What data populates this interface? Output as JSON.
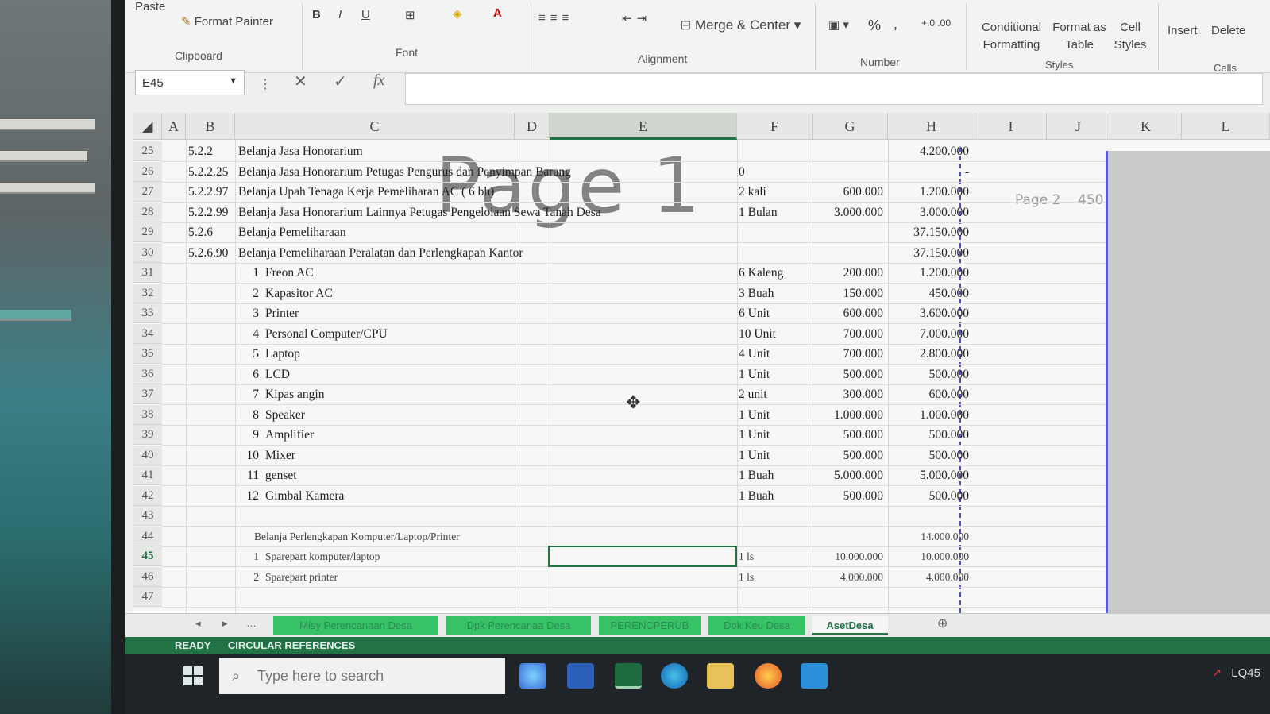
{
  "ribbon": {
    "paste": "Paste",
    "format_painter": "Format Painter",
    "clipboard_group": "Clipboard",
    "bold": "B",
    "italic": "I",
    "underline": "U",
    "font_group": "Font",
    "merge_center": "Merge & Center",
    "alignment_group": "Alignment",
    "percent": "%",
    "comma": ",",
    "number_group": "Number",
    "conditional_formatting": "Conditional Formatting",
    "format_as_table": "Format as Table",
    "cell_styles": "Cell Styles",
    "styles_group": "Styles",
    "insert": "Insert",
    "delete": "Delete",
    "cells_group": "Cells"
  },
  "formula_bar": {
    "name_box": "E45",
    "cancel": "✕",
    "enter": "✓",
    "fx": "fx",
    "formula": ""
  },
  "columns": [
    "A",
    "B",
    "C",
    "D",
    "E",
    "F",
    "G",
    "H",
    "I",
    "J",
    "K",
    "L"
  ],
  "selected_column": "E",
  "selected_row": "45",
  "rows": [
    {
      "num": "25",
      "b": "5.2.2",
      "c": "Belanja Jasa Honorarium",
      "f": "",
      "g": "",
      "h": "4.200.000"
    },
    {
      "num": "26",
      "b": "5.2.2.25",
      "c": "Belanja Jasa Honorarium Petugas Pengurus dan Penyimpan Barang",
      "f": "0",
      "g": "",
      "h": "-"
    },
    {
      "num": "27",
      "b": "5.2.2.97",
      "c": "Belanja Upah Tenaga Kerja Pemeliharan AC ( 6 bh)",
      "f": "2 kali",
      "g": "600.000",
      "h": "1.200.000"
    },
    {
      "num": "28",
      "b": "5.2.2.99",
      "c": "Belanja Jasa Honorarium Lainnya Petugas Pengelolaan Sewa Tanah Desa",
      "f": "1 Bulan",
      "g": "3.000.000",
      "h": "3.000.000"
    },
    {
      "num": "29",
      "b": "5.2.6",
      "c": "Belanja Pemeliharaan",
      "f": "",
      "g": "",
      "h": "37.150.000"
    },
    {
      "num": "30",
      "b": "5.2.6.90",
      "c": "Belanja Pemeliharaan Peralatan dan Perlengkapan Kantor",
      "f": "",
      "g": "",
      "h": "37.150.000"
    },
    {
      "num": "31",
      "b": "",
      "n": "1",
      "c": "Freon AC",
      "f": "6 Kaleng",
      "g": "200.000",
      "h": "1.200.000"
    },
    {
      "num": "32",
      "b": "",
      "n": "2",
      "c": "Kapasitor AC",
      "f": "3 Buah",
      "g": "150.000",
      "h": "450.000"
    },
    {
      "num": "33",
      "b": "",
      "n": "3",
      "c": "Printer",
      "f": "6 Unit",
      "g": "600.000",
      "h": "3.600.000"
    },
    {
      "num": "34",
      "b": "",
      "n": "4",
      "c": "Personal Computer/CPU",
      "f": "10 Unit",
      "g": "700.000",
      "h": "7.000.000"
    },
    {
      "num": "35",
      "b": "",
      "n": "5",
      "c": "Laptop",
      "f": "4 Unit",
      "g": "700.000",
      "h": "2.800.000"
    },
    {
      "num": "36",
      "b": "",
      "n": "6",
      "c": "LCD",
      "f": "1 Unit",
      "g": "500.000",
      "h": "500.000"
    },
    {
      "num": "37",
      "b": "",
      "n": "7",
      "c": "Kipas angin",
      "f": "2 unit",
      "g": "300.000",
      "h": "600.000"
    },
    {
      "num": "38",
      "b": "",
      "n": "8",
      "c": "Speaker",
      "f": "1 Unit",
      "g": "1.000.000",
      "h": "1.000.000"
    },
    {
      "num": "39",
      "b": "",
      "n": "9",
      "c": "Amplifier",
      "f": "1 Unit",
      "g": "500.000",
      "h": "500.000"
    },
    {
      "num": "40",
      "b": "",
      "n": "10",
      "c": "Mixer",
      "f": "1 Unit",
      "g": "500.000",
      "h": "500.000"
    },
    {
      "num": "41",
      "b": "",
      "n": "11",
      "c": "genset",
      "f": "1 Buah",
      "g": "5.000.000",
      "h": "5.000.000"
    },
    {
      "num": "42",
      "b": "",
      "n": "12",
      "c": "Gimbal Kamera",
      "f": "1 Buah",
      "g": "500.000",
      "h": "500.000"
    },
    {
      "num": "43",
      "b": "",
      "c": "",
      "f": "",
      "g": "",
      "h": ""
    },
    {
      "num": "44",
      "b": "",
      "c": "Belanja Perlengkapan Komputer/Laptop/Printer",
      "f": "",
      "g": "",
      "h": "14.000.000"
    },
    {
      "num": "45",
      "b": "",
      "n": "1",
      "c": "Sparepart komputer/laptop",
      "f": "1 ls",
      "g": "10.000.000",
      "h": "10.000.000"
    },
    {
      "num": "46",
      "b": "",
      "n": "2",
      "c": "Sparepart printer",
      "f": "1 ls",
      "g": "4.000.000",
      "h": "4.000.000"
    },
    {
      "num": "47",
      "b": "",
      "c": "",
      "f": "",
      "g": "",
      "h": ""
    }
  ],
  "watermark": {
    "page1": "Page 1",
    "page2": "Page 2",
    "page2_value": "450"
  },
  "sheet_tabs": [
    "Misy Perencanaan Desa",
    "Dpk Perencanaa Desa",
    "PERENCPERUB",
    "Dok Keu Desa",
    "AsetDesa"
  ],
  "active_tab": "AsetDesa",
  "status": {
    "ready": "READY",
    "circular": "CIRCULAR REFERENCES"
  },
  "taskbar": {
    "search_placeholder": "Type here to search",
    "tray_text": "LQ45"
  },
  "colors": {
    "excel_green": "#217346",
    "tab_green": "#37c266",
    "page_break": "#4b50c7"
  }
}
